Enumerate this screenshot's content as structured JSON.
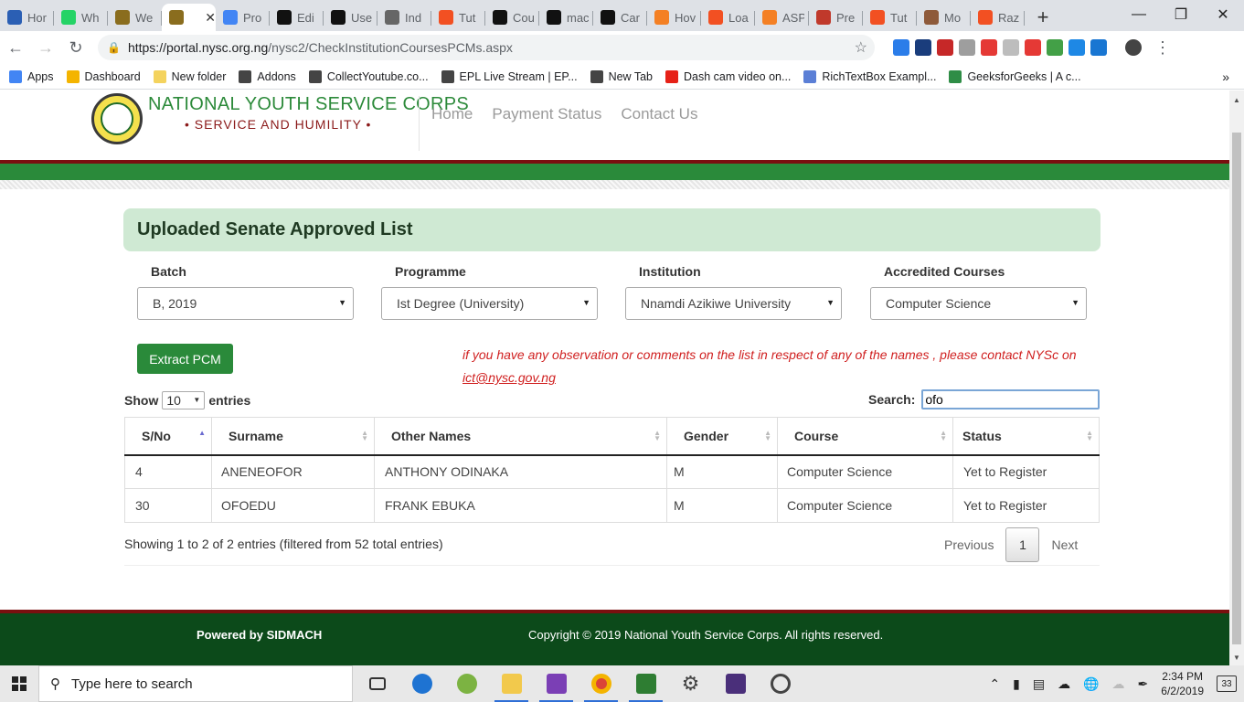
{
  "browser": {
    "tabs": [
      {
        "label": "Hor",
        "color": "#2b5fb4"
      },
      {
        "label": "Wh",
        "color": "#25d366"
      },
      {
        "label": "We",
        "color": "#8a6d1e"
      },
      {
        "label": "",
        "color": "#8a6d1e",
        "active": true
      },
      {
        "label": "Pro",
        "color": "#4285f4"
      },
      {
        "label": "Edi",
        "color": "#111111"
      },
      {
        "label": "Use",
        "color": "#111111"
      },
      {
        "label": "Ind",
        "color": "#666666"
      },
      {
        "label": "Tut",
        "color": "#f25022"
      },
      {
        "label": "Cou",
        "color": "#111111"
      },
      {
        "label": "mac",
        "color": "#111111"
      },
      {
        "label": "Car",
        "color": "#111111"
      },
      {
        "label": "Hov",
        "color": "#f48024"
      },
      {
        "label": "Loa",
        "color": "#f25022"
      },
      {
        "label": "ASP",
        "color": "#f48024"
      },
      {
        "label": "Pre",
        "color": "#c0392b"
      },
      {
        "label": "Tut",
        "color": "#f25022"
      },
      {
        "label": "Mo",
        "color": "#8e5a3a"
      },
      {
        "label": "Raz",
        "color": "#f25022"
      }
    ],
    "new_tab": "+",
    "url_host": "https://portal.nysc.org.ng",
    "url_path": "/nysc2/CheckInstitutionCoursesPCMs.aspx",
    "bookmarks": [
      {
        "label": "Apps",
        "color": "#4285f4"
      },
      {
        "label": "Dashboard",
        "color": "#f4b400"
      },
      {
        "label": "New folder",
        "color": "#f4d35e"
      },
      {
        "label": "Addons",
        "color": "#444444"
      },
      {
        "label": "CollectYoutube.co...",
        "color": "#444444"
      },
      {
        "label": "EPL Live Stream | EP...",
        "color": "#444444"
      },
      {
        "label": "New Tab",
        "color": "#444444"
      },
      {
        "label": "Dash cam video on...",
        "color": "#e62117"
      },
      {
        "label": "RichTextBox Exampl...",
        "color": "#5b7fd6"
      },
      {
        "label": "GeeksforGeeks | A c...",
        "color": "#2f8d46"
      }
    ],
    "bookmarks_more": "»"
  },
  "site": {
    "brand_name": "NATIONAL YOUTH SERVICE CORPS",
    "motto": "• SERVICE AND HUMILITY •",
    "nav": [
      "Home",
      "Payment Status",
      "Contact Us"
    ]
  },
  "panel": {
    "title": "Uploaded Senate Approved List"
  },
  "filters": [
    {
      "label": "Batch",
      "value": "B, 2019"
    },
    {
      "label": "Programme",
      "value": "Ist Degree (University)"
    },
    {
      "label": "Institution",
      "value": "Nnamdi Azikiwe University"
    },
    {
      "label": "Accredited Courses",
      "value": "Computer Science"
    }
  ],
  "extract_button": "Extract PCM",
  "notice": {
    "text": "if you have any observation or comments on the list in respect of any of the names , please contact NYSc on",
    "email": "ict@nysc.gov.ng"
  },
  "table_controls": {
    "show_label": "Show",
    "page_length": "10",
    "entries_label": "entries",
    "search_label": "Search:",
    "search_value": "ofo"
  },
  "table": {
    "columns": [
      "S/No",
      "Surname",
      "Other Names",
      "Gender",
      "Course",
      "Status"
    ],
    "rows": [
      [
        "4",
        "ANENEOFOR",
        "ANTHONY ODINAKA",
        "M",
        "Computer Science",
        "Yet to Register"
      ],
      [
        "30",
        "OFOEDU",
        "FRANK EBUKA",
        "M",
        "Computer Science",
        "Yet to Register"
      ]
    ]
  },
  "pagination": {
    "info": "Showing 1 to 2 of 2 entries (filtered from 52 total entries)",
    "previous": "Previous",
    "current": "1",
    "next": "Next"
  },
  "footer": {
    "powered_by": "Powered by SIDMACH",
    "copyright": "Copyright © 2019 National Youth Service Corps. All rights reserved."
  },
  "taskbar": {
    "search_placeholder": "Type here to search",
    "time": "2:34 PM",
    "date": "6/2/2019",
    "notification_count": "33"
  }
}
